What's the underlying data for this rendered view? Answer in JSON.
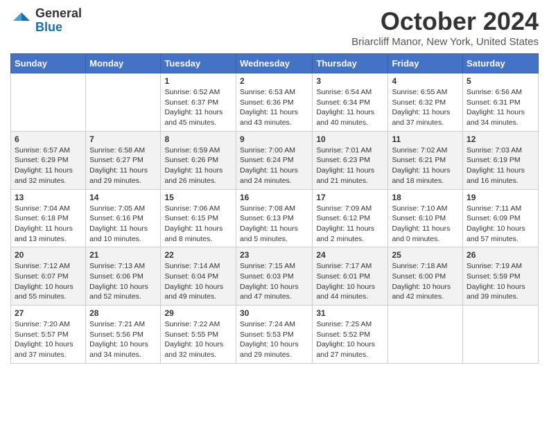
{
  "logo": {
    "general": "General",
    "blue": "Blue"
  },
  "header": {
    "month": "October 2024",
    "location": "Briarcliff Manor, New York, United States"
  },
  "weekdays": [
    "Sunday",
    "Monday",
    "Tuesday",
    "Wednesday",
    "Thursday",
    "Friday",
    "Saturday"
  ],
  "weeks": [
    [
      {
        "day": "",
        "info": ""
      },
      {
        "day": "",
        "info": ""
      },
      {
        "day": "1",
        "info": "Sunrise: 6:52 AM\nSunset: 6:37 PM\nDaylight: 11 hours and 45 minutes."
      },
      {
        "day": "2",
        "info": "Sunrise: 6:53 AM\nSunset: 6:36 PM\nDaylight: 11 hours and 43 minutes."
      },
      {
        "day": "3",
        "info": "Sunrise: 6:54 AM\nSunset: 6:34 PM\nDaylight: 11 hours and 40 minutes."
      },
      {
        "day": "4",
        "info": "Sunrise: 6:55 AM\nSunset: 6:32 PM\nDaylight: 11 hours and 37 minutes."
      },
      {
        "day": "5",
        "info": "Sunrise: 6:56 AM\nSunset: 6:31 PM\nDaylight: 11 hours and 34 minutes."
      }
    ],
    [
      {
        "day": "6",
        "info": "Sunrise: 6:57 AM\nSunset: 6:29 PM\nDaylight: 11 hours and 32 minutes."
      },
      {
        "day": "7",
        "info": "Sunrise: 6:58 AM\nSunset: 6:27 PM\nDaylight: 11 hours and 29 minutes."
      },
      {
        "day": "8",
        "info": "Sunrise: 6:59 AM\nSunset: 6:26 PM\nDaylight: 11 hours and 26 minutes."
      },
      {
        "day": "9",
        "info": "Sunrise: 7:00 AM\nSunset: 6:24 PM\nDaylight: 11 hours and 24 minutes."
      },
      {
        "day": "10",
        "info": "Sunrise: 7:01 AM\nSunset: 6:23 PM\nDaylight: 11 hours and 21 minutes."
      },
      {
        "day": "11",
        "info": "Sunrise: 7:02 AM\nSunset: 6:21 PM\nDaylight: 11 hours and 18 minutes."
      },
      {
        "day": "12",
        "info": "Sunrise: 7:03 AM\nSunset: 6:19 PM\nDaylight: 11 hours and 16 minutes."
      }
    ],
    [
      {
        "day": "13",
        "info": "Sunrise: 7:04 AM\nSunset: 6:18 PM\nDaylight: 11 hours and 13 minutes."
      },
      {
        "day": "14",
        "info": "Sunrise: 7:05 AM\nSunset: 6:16 PM\nDaylight: 11 hours and 10 minutes."
      },
      {
        "day": "15",
        "info": "Sunrise: 7:06 AM\nSunset: 6:15 PM\nDaylight: 11 hours and 8 minutes."
      },
      {
        "day": "16",
        "info": "Sunrise: 7:08 AM\nSunset: 6:13 PM\nDaylight: 11 hours and 5 minutes."
      },
      {
        "day": "17",
        "info": "Sunrise: 7:09 AM\nSunset: 6:12 PM\nDaylight: 11 hours and 2 minutes."
      },
      {
        "day": "18",
        "info": "Sunrise: 7:10 AM\nSunset: 6:10 PM\nDaylight: 11 hours and 0 minutes."
      },
      {
        "day": "19",
        "info": "Sunrise: 7:11 AM\nSunset: 6:09 PM\nDaylight: 10 hours and 57 minutes."
      }
    ],
    [
      {
        "day": "20",
        "info": "Sunrise: 7:12 AM\nSunset: 6:07 PM\nDaylight: 10 hours and 55 minutes."
      },
      {
        "day": "21",
        "info": "Sunrise: 7:13 AM\nSunset: 6:06 PM\nDaylight: 10 hours and 52 minutes."
      },
      {
        "day": "22",
        "info": "Sunrise: 7:14 AM\nSunset: 6:04 PM\nDaylight: 10 hours and 49 minutes."
      },
      {
        "day": "23",
        "info": "Sunrise: 7:15 AM\nSunset: 6:03 PM\nDaylight: 10 hours and 47 minutes."
      },
      {
        "day": "24",
        "info": "Sunrise: 7:17 AM\nSunset: 6:01 PM\nDaylight: 10 hours and 44 minutes."
      },
      {
        "day": "25",
        "info": "Sunrise: 7:18 AM\nSunset: 6:00 PM\nDaylight: 10 hours and 42 minutes."
      },
      {
        "day": "26",
        "info": "Sunrise: 7:19 AM\nSunset: 5:59 PM\nDaylight: 10 hours and 39 minutes."
      }
    ],
    [
      {
        "day": "27",
        "info": "Sunrise: 7:20 AM\nSunset: 5:57 PM\nDaylight: 10 hours and 37 minutes."
      },
      {
        "day": "28",
        "info": "Sunrise: 7:21 AM\nSunset: 5:56 PM\nDaylight: 10 hours and 34 minutes."
      },
      {
        "day": "29",
        "info": "Sunrise: 7:22 AM\nSunset: 5:55 PM\nDaylight: 10 hours and 32 minutes."
      },
      {
        "day": "30",
        "info": "Sunrise: 7:24 AM\nSunset: 5:53 PM\nDaylight: 10 hours and 29 minutes."
      },
      {
        "day": "31",
        "info": "Sunrise: 7:25 AM\nSunset: 5:52 PM\nDaylight: 10 hours and 27 minutes."
      },
      {
        "day": "",
        "info": ""
      },
      {
        "day": "",
        "info": ""
      }
    ]
  ]
}
